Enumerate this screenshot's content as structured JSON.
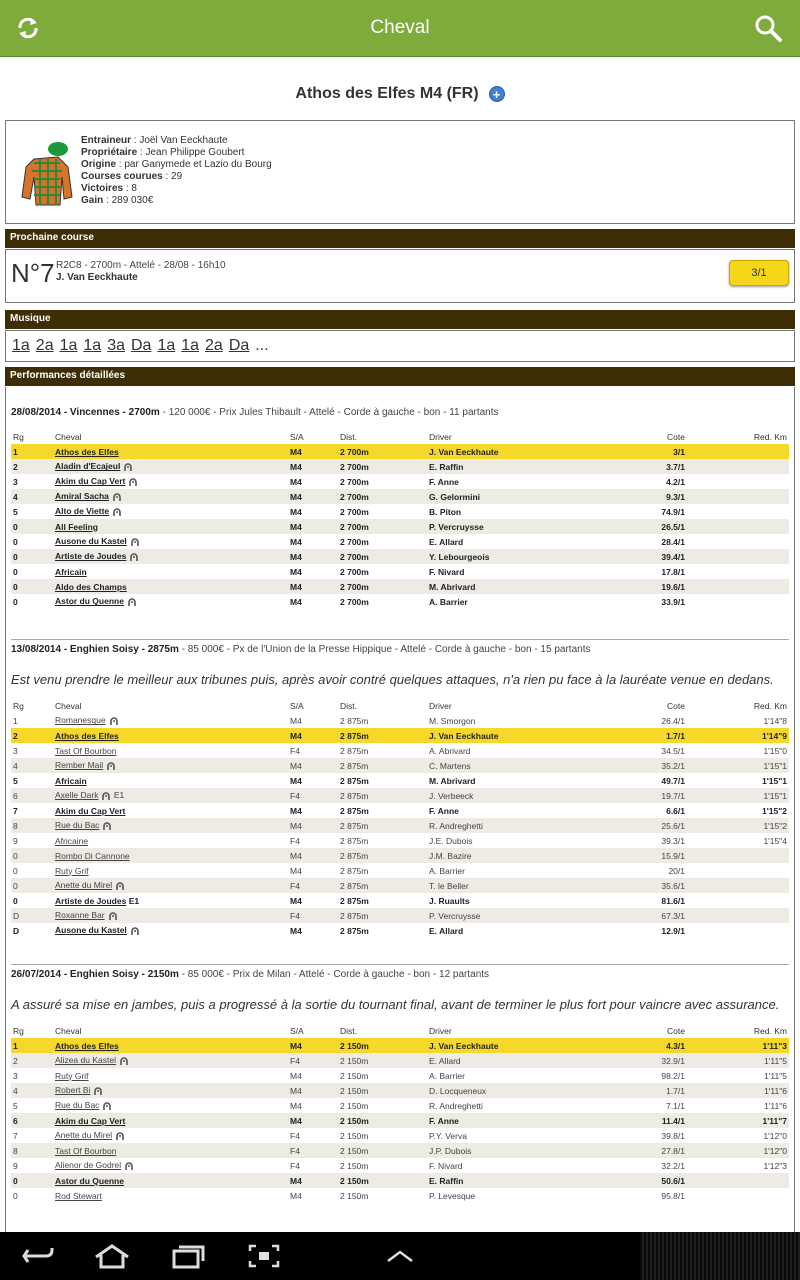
{
  "app": {
    "title": "Cheval",
    "refresh_icon": "refresh-icon",
    "search_icon": "search-icon"
  },
  "horse": {
    "name": "Athos des Elfes M4 (FR)",
    "trainer_label": "Entraineur",
    "trainer": "Joël Van Eeckhaute",
    "owner_label": "Propriétaire",
    "owner": "Jean Philippe Goubert",
    "origin_label": "Origine",
    "origin": "par Ganymede et Lazio du Bourg",
    "races_label": "Courses courues",
    "races": "29",
    "wins_label": "Victoires",
    "wins": "8",
    "gain_label": "Gain",
    "gain": "289 030€"
  },
  "next_race": {
    "header": "Prochaine course",
    "number": "N°7",
    "line1": "R2C8 - 2700m - Attelé - 28/08 - 16h10",
    "driver": "J. Van Eeckhaute",
    "cote": "3/1"
  },
  "musique": {
    "header": "Musique",
    "items": [
      "1a",
      "2a",
      "1a",
      "1a",
      "3a",
      "Da",
      "1a",
      "1a",
      "2a",
      "Da"
    ],
    "more": "..."
  },
  "perf_header": "Performances détaillées",
  "columns": {
    "rg": "Rg",
    "cheval": "Cheval",
    "sa": "S/A",
    "dist": "Dist.",
    "driver": "Driver",
    "cote": "Cote",
    "red": "Red. Km"
  },
  "races": [
    {
      "head_bold": "28/08/2014 - Vincennes - 2700m",
      "head_rest": " - 120 000€ - Prix Jules Thibault - Attelé - Corde à gauche - bon - 11 partants",
      "comment": "",
      "rows": [
        {
          "rg": "1",
          "cheval": "Athos des Elfes",
          "shoe": false,
          "e": "",
          "sa": "M4",
          "dist": "2 700m",
          "driver": "J. Van Eeckhaute",
          "cote": "3/1",
          "red": "",
          "style": "hl"
        },
        {
          "rg": "2",
          "cheval": "Aladin d'Ecajeul",
          "shoe": true,
          "e": "",
          "sa": "M4",
          "dist": "2 700m",
          "driver": "E. Raffin",
          "cote": "3.7/1",
          "red": "",
          "style": "bold"
        },
        {
          "rg": "3",
          "cheval": "Akim du Cap Vert",
          "shoe": true,
          "e": "",
          "sa": "M4",
          "dist": "2 700m",
          "driver": "F. Anne",
          "cote": "4.2/1",
          "red": "",
          "style": "bold"
        },
        {
          "rg": "4",
          "cheval": "Amiral Sacha",
          "shoe": true,
          "e": "",
          "sa": "M4",
          "dist": "2 700m",
          "driver": "G. Gelormini",
          "cote": "9.3/1",
          "red": "",
          "style": "bold"
        },
        {
          "rg": "5",
          "cheval": "Alto de Viette",
          "shoe": true,
          "e": "",
          "sa": "M4",
          "dist": "2 700m",
          "driver": "B. Piton",
          "cote": "74.9/1",
          "red": "",
          "style": "bold"
        },
        {
          "rg": "0",
          "cheval": "All Feeling",
          "shoe": false,
          "e": "",
          "sa": "M4",
          "dist": "2 700m",
          "driver": "P. Vercruysse",
          "cote": "26.5/1",
          "red": "",
          "style": "bold"
        },
        {
          "rg": "0",
          "cheval": "Ausone du Kastel",
          "shoe": true,
          "e": "",
          "sa": "M4",
          "dist": "2 700m",
          "driver": "E. Allard",
          "cote": "28.4/1",
          "red": "",
          "style": "bold"
        },
        {
          "rg": "0",
          "cheval": "Artiste de Joudes",
          "shoe": true,
          "e": "",
          "sa": "M4",
          "dist": "2 700m",
          "driver": "Y. Lebourgeois",
          "cote": "39.4/1",
          "red": "",
          "style": "bold"
        },
        {
          "rg": "0",
          "cheval": "Africain",
          "shoe": false,
          "e": "",
          "sa": "M4",
          "dist": "2 700m",
          "driver": "F. Nivard",
          "cote": "17.8/1",
          "red": "",
          "style": "bold"
        },
        {
          "rg": "0",
          "cheval": "Aldo des Champs",
          "shoe": false,
          "e": "",
          "sa": "M4",
          "dist": "2 700m",
          "driver": "M. Abrivard",
          "cote": "19.6/1",
          "red": "",
          "style": "bold"
        },
        {
          "rg": "0",
          "cheval": "Astor du Quenne",
          "shoe": true,
          "e": "",
          "sa": "M4",
          "dist": "2 700m",
          "driver": "A. Barrier",
          "cote": "33.9/1",
          "red": "",
          "style": "bold"
        }
      ]
    },
    {
      "head_bold": "13/08/2014 - Enghien Soisy - 2875m",
      "head_rest": " - 85 000€ - Px de l'Union de la Presse Hippique - Attelé - Corde à gauche - bon - 15 partants",
      "comment": "Est venu prendre le meilleur aux tribunes puis, après avoir contré quelques attaques, n'a rien pu face à la lauréate venue en dedans.",
      "rows": [
        {
          "rg": "1",
          "cheval": "Romanesque",
          "shoe": true,
          "e": "",
          "sa": "M4",
          "dist": "2 875m",
          "driver": "M. Smorgon",
          "cote": "26.4/1",
          "red": "1'14\"8",
          "style": ""
        },
        {
          "rg": "2",
          "cheval": "Athos des Elfes",
          "shoe": false,
          "e": "",
          "sa": "M4",
          "dist": "2 875m",
          "driver": "J. Van Eeckhaute",
          "cote": "1.7/1",
          "red": "1'14\"9",
          "style": "hl"
        },
        {
          "rg": "3",
          "cheval": "Tast Of Bourbon",
          "shoe": false,
          "e": "",
          "sa": "F4",
          "dist": "2 875m",
          "driver": "A. Abrivard",
          "cote": "34.5/1",
          "red": "1'15\"0",
          "style": ""
        },
        {
          "rg": "4",
          "cheval": "Rember Mail",
          "shoe": true,
          "e": "",
          "sa": "M4",
          "dist": "2 875m",
          "driver": "C. Martens",
          "cote": "35.2/1",
          "red": "1'15\"1",
          "style": ""
        },
        {
          "rg": "5",
          "cheval": "Africain",
          "shoe": false,
          "e": "",
          "sa": "M4",
          "dist": "2 875m",
          "driver": "M. Abrivard",
          "cote": "49.7/1",
          "red": "1'15\"1",
          "style": "bold"
        },
        {
          "rg": "6",
          "cheval": "Axelle Dark",
          "shoe": true,
          "e": "E1",
          "sa": "F4",
          "dist": "2 875m",
          "driver": "J. Verbeeck",
          "cote": "19.7/1",
          "red": "1'15\"1",
          "style": ""
        },
        {
          "rg": "7",
          "cheval": "Akim du Cap Vert",
          "shoe": false,
          "e": "",
          "sa": "M4",
          "dist": "2 875m",
          "driver": "F. Anne",
          "cote": "6.6/1",
          "red": "1'15\"2",
          "style": "bold"
        },
        {
          "rg": "8",
          "cheval": "Rue du Bac",
          "shoe": true,
          "e": "",
          "sa": "M4",
          "dist": "2 875m",
          "driver": "R. Andreghetti",
          "cote": "25.6/1",
          "red": "1'15\"2",
          "style": ""
        },
        {
          "rg": "9",
          "cheval": "Africaine",
          "shoe": false,
          "e": "",
          "sa": "F4",
          "dist": "2 875m",
          "driver": "J.E. Dubois",
          "cote": "39.3/1",
          "red": "1'15\"4",
          "style": ""
        },
        {
          "rg": "0",
          "cheval": "Rombo Di Cannone",
          "shoe": false,
          "e": "",
          "sa": "M4",
          "dist": "2 875m",
          "driver": "J.M. Bazire",
          "cote": "15.9/1",
          "red": "",
          "style": ""
        },
        {
          "rg": "0",
          "cheval": "Ruty Grif",
          "shoe": false,
          "e": "",
          "sa": "M4",
          "dist": "2 875m",
          "driver": "A. Barrier",
          "cote": "20/1",
          "red": "",
          "style": ""
        },
        {
          "rg": "0",
          "cheval": "Anette du Mirel",
          "shoe": true,
          "e": "",
          "sa": "F4",
          "dist": "2 875m",
          "driver": "T. le Beller",
          "cote": "35.6/1",
          "red": "",
          "style": ""
        },
        {
          "rg": "0",
          "cheval": "Artiste de Joudes",
          "shoe": false,
          "e": "E1",
          "sa": "M4",
          "dist": "2 875m",
          "driver": "J. Ruaults",
          "cote": "81.6/1",
          "red": "",
          "style": "bold"
        },
        {
          "rg": "D",
          "cheval": "Roxanne Bar",
          "shoe": true,
          "e": "",
          "sa": "F4",
          "dist": "2 875m",
          "driver": "P. Vercruysse",
          "cote": "67.3/1",
          "red": "",
          "style": ""
        },
        {
          "rg": "D",
          "cheval": "Ausone du Kastel",
          "shoe": true,
          "e": "",
          "sa": "M4",
          "dist": "2 875m",
          "driver": "E. Allard",
          "cote": "12.9/1",
          "red": "",
          "style": "bold"
        }
      ]
    },
    {
      "head_bold": "26/07/2014 - Enghien Soisy - 2150m",
      "head_rest": " - 85 000€ - Prix de Milan - Attelé - Corde à gauche - bon - 12 partants",
      "comment": "A assuré sa mise en jambes, puis a progressé à la sortie du tournant final, avant de terminer le plus fort pour vaincre avec assurance.",
      "rows": [
        {
          "rg": "1",
          "cheval": "Athos des Elfes",
          "shoe": false,
          "e": "",
          "sa": "M4",
          "dist": "2 150m",
          "driver": "J. Van Eeckhaute",
          "cote": "4.3/1",
          "red": "1'11\"3",
          "style": "hl"
        },
        {
          "rg": "2",
          "cheval": "Alizea du Kastel",
          "shoe": true,
          "e": "",
          "sa": "F4",
          "dist": "2 150m",
          "driver": "E. Allard",
          "cote": "32.9/1",
          "red": "1'11\"5",
          "style": ""
        },
        {
          "rg": "3",
          "cheval": "Ruty Grif",
          "shoe": false,
          "e": "",
          "sa": "M4",
          "dist": "2 150m",
          "driver": "A. Barrier",
          "cote": "98.2/1",
          "red": "1'11\"5",
          "style": ""
        },
        {
          "rg": "4",
          "cheval": "Robert Bi",
          "shoe": true,
          "e": "",
          "sa": "M4",
          "dist": "2 150m",
          "driver": "D. Locqueneux",
          "cote": "1.7/1",
          "red": "1'11\"6",
          "style": ""
        },
        {
          "rg": "5",
          "cheval": "Rue du Bac",
          "shoe": true,
          "e": "",
          "sa": "M4",
          "dist": "2 150m",
          "driver": "R. Andreghetti",
          "cote": "7.1/1",
          "red": "1'11\"6",
          "style": ""
        },
        {
          "rg": "6",
          "cheval": "Akim du Cap Vert",
          "shoe": false,
          "e": "",
          "sa": "M4",
          "dist": "2 150m",
          "driver": "F. Anne",
          "cote": "11.4/1",
          "red": "1'11\"7",
          "style": "bold"
        },
        {
          "rg": "7",
          "cheval": "Anette du Mirel",
          "shoe": true,
          "e": "",
          "sa": "F4",
          "dist": "2 150m",
          "driver": "P.Y. Verva",
          "cote": "39.8/1",
          "red": "1'12\"0",
          "style": ""
        },
        {
          "rg": "8",
          "cheval": "Tast Of Bourbon",
          "shoe": false,
          "e": "",
          "sa": "F4",
          "dist": "2 150m",
          "driver": "J.P. Dubois",
          "cote": "27.8/1",
          "red": "1'12\"0",
          "style": ""
        },
        {
          "rg": "9",
          "cheval": "Alienor de Godrel",
          "shoe": true,
          "e": "",
          "sa": "F4",
          "dist": "2 150m",
          "driver": "F. Nivard",
          "cote": "32.2/1",
          "red": "1'12\"3",
          "style": ""
        },
        {
          "rg": "0",
          "cheval": "Astor du Quenne",
          "shoe": false,
          "e": "",
          "sa": "M4",
          "dist": "2 150m",
          "driver": "E. Raffin",
          "cote": "50.6/1",
          "red": "",
          "style": "bold"
        },
        {
          "rg": "0",
          "cheval": "Rod Stewart",
          "shoe": false,
          "e": "",
          "sa": "M4",
          "dist": "2 150m",
          "driver": "P. Levesque",
          "cote": "95.8/1",
          "red": "",
          "style": ""
        }
      ]
    }
  ],
  "navbar": {
    "back_icon": "back-icon",
    "home_icon": "home-icon",
    "recent_icon": "recent-apps-icon",
    "screenshot_icon": "screenshot-icon",
    "up_icon": "chevron-up-icon"
  }
}
